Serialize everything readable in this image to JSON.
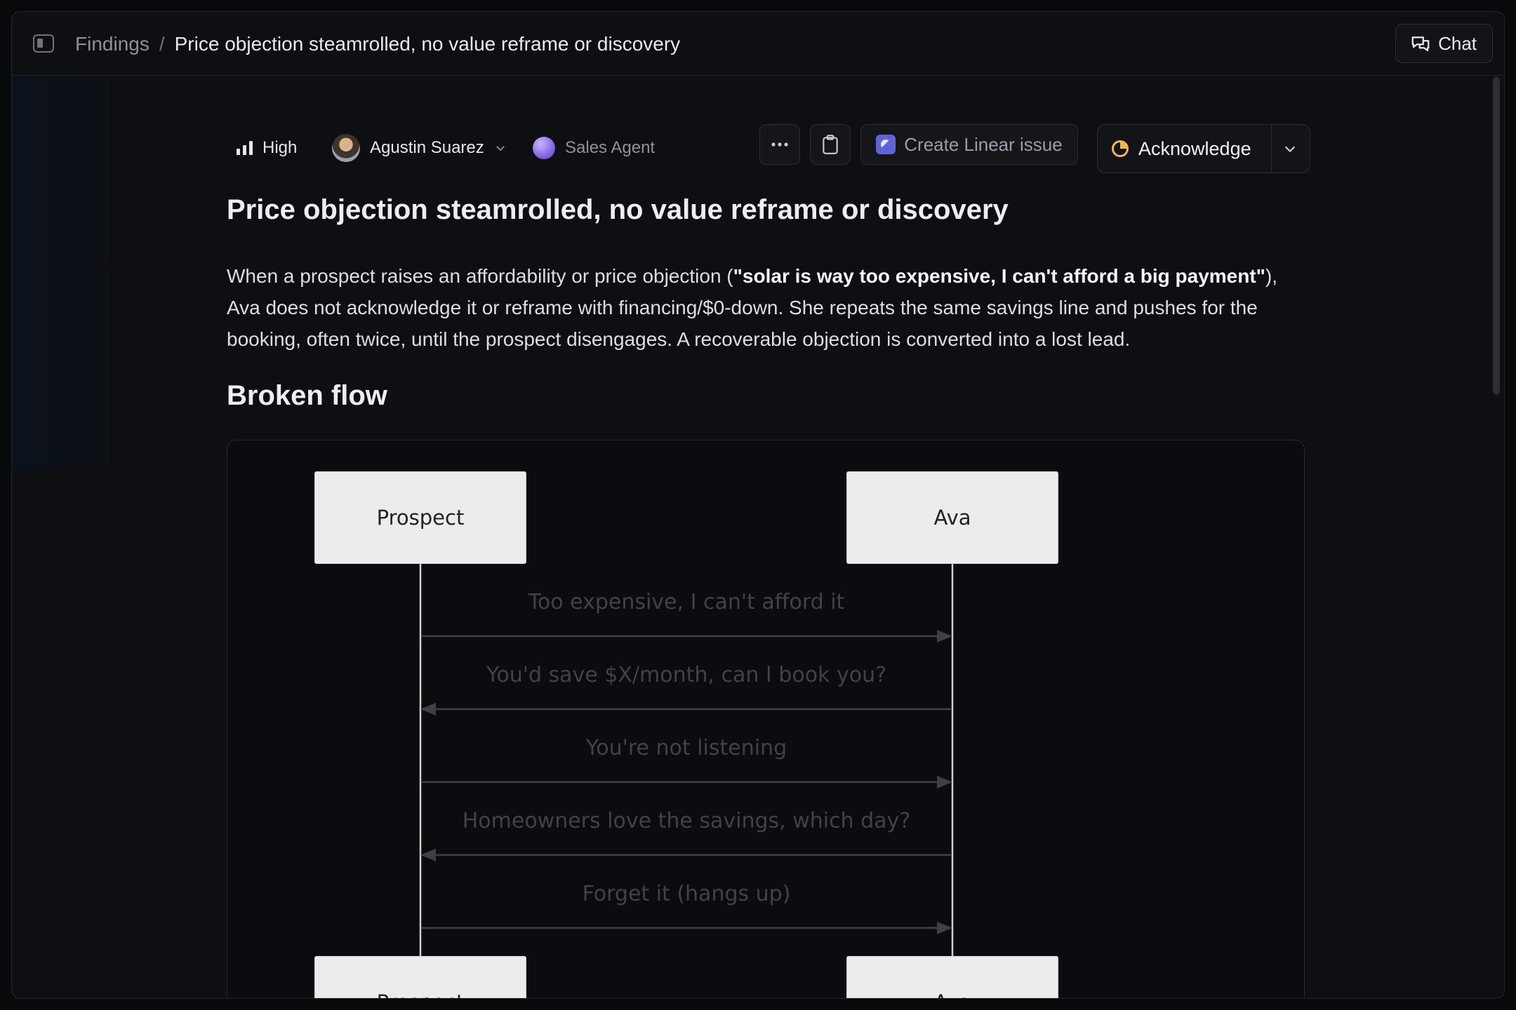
{
  "topbar": {
    "breadcrumb_root": "Findings",
    "breadcrumb_sep": "/",
    "breadcrumb_current": "Price objection steamrolled, no value reframe or discovery",
    "chat_label": "Chat"
  },
  "meta": {
    "priority": "High",
    "assignee": "Agustin Suarez",
    "agent": "Sales Agent",
    "create_issue_label": "Create Linear issue",
    "acknowledge_label": "Acknowledge",
    "accent_color": "#f2b84b",
    "linear_color": "#5e63d6"
  },
  "finding": {
    "title": "Price objection steamrolled, no value reframe or discovery",
    "desc_pre": "When a prospect raises an affordability or price objection (",
    "desc_bold": "\"solar is way too expensive, I can't afford a big payment\"",
    "desc_post": "), Ava does not acknowledge it or reframe with financing/$0-down. She repeats the same savings line and pushes for the booking, often twice, until the prospect disengages. A recoverable objection is converted into a lost lead.",
    "section_title": "Broken flow"
  },
  "sequence": {
    "actors": [
      "Prospect",
      "Ava"
    ],
    "messages": [
      {
        "from": "Prospect",
        "to": "Ava",
        "text": "Too expensive, I can't afford it"
      },
      {
        "from": "Ava",
        "to": "Prospect",
        "text": "You'd save $X/month, can I book you?"
      },
      {
        "from": "Prospect",
        "to": "Ava",
        "text": "You're not listening"
      },
      {
        "from": "Ava",
        "to": "Prospect",
        "text": "Homeowners love the savings, which day?"
      },
      {
        "from": "Prospect",
        "to": "Ava",
        "text": "Forget it (hangs up)"
      }
    ]
  }
}
